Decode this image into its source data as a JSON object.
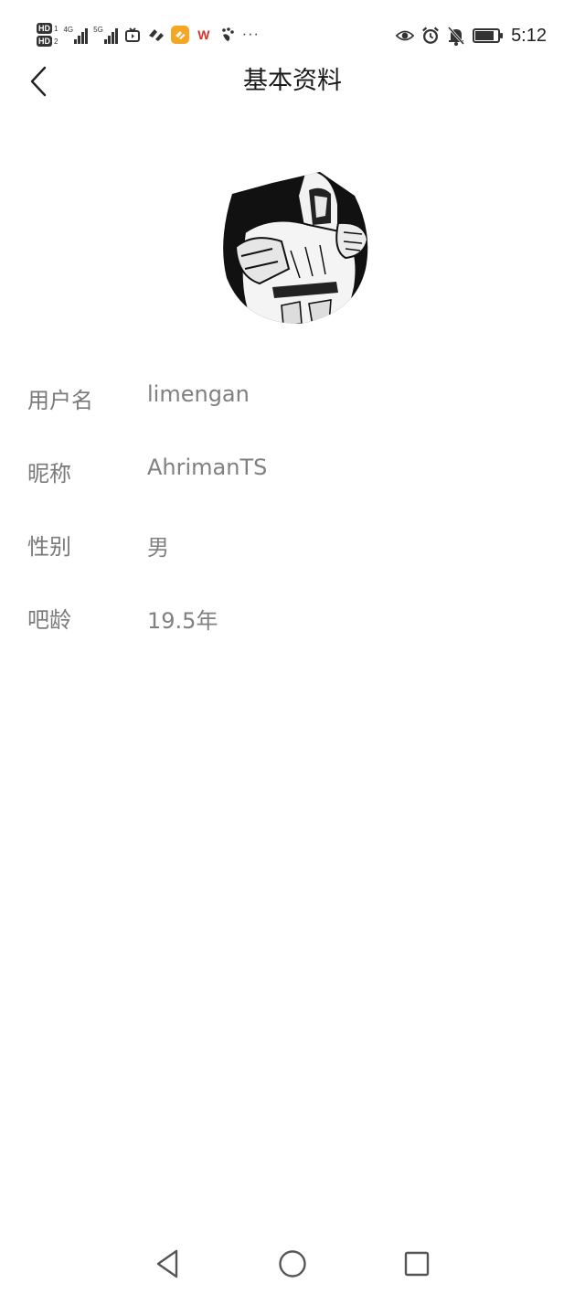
{
  "status_bar": {
    "hd1": "HD",
    "hd1_num": "1",
    "hd2": "HD",
    "hd2_num": "2",
    "net1": "4G",
    "net2": "5G",
    "wps_label": "W",
    "more": "···",
    "time": "5:12",
    "battery_level": 0.85,
    "icons": [
      "signal-icon",
      "tv-icon",
      "app-icon",
      "orange-app-icon",
      "wps-icon",
      "paw-icon",
      "eye-icon",
      "alarm-icon",
      "mute-bell-icon",
      "battery-icon"
    ]
  },
  "header": {
    "title": "基本资料",
    "back_icon": "chevron-left-icon"
  },
  "profile": {
    "avatar_icon": "avatar-image",
    "rows": [
      {
        "label": "用户名",
        "value": "limengan"
      },
      {
        "label": "昵称",
        "value": "AhrimanTS"
      },
      {
        "label": "性别",
        "value": "男"
      },
      {
        "label": "吧龄",
        "value": "19.5年"
      }
    ]
  },
  "nav_bar": {
    "back": "triangle-back-icon",
    "home": "circle-home-icon",
    "recents": "square-recents-icon"
  },
  "colors": {
    "label": "#7a7a7a",
    "value": "#808080",
    "title": "#1a1a1a",
    "background": "#ffffff"
  }
}
